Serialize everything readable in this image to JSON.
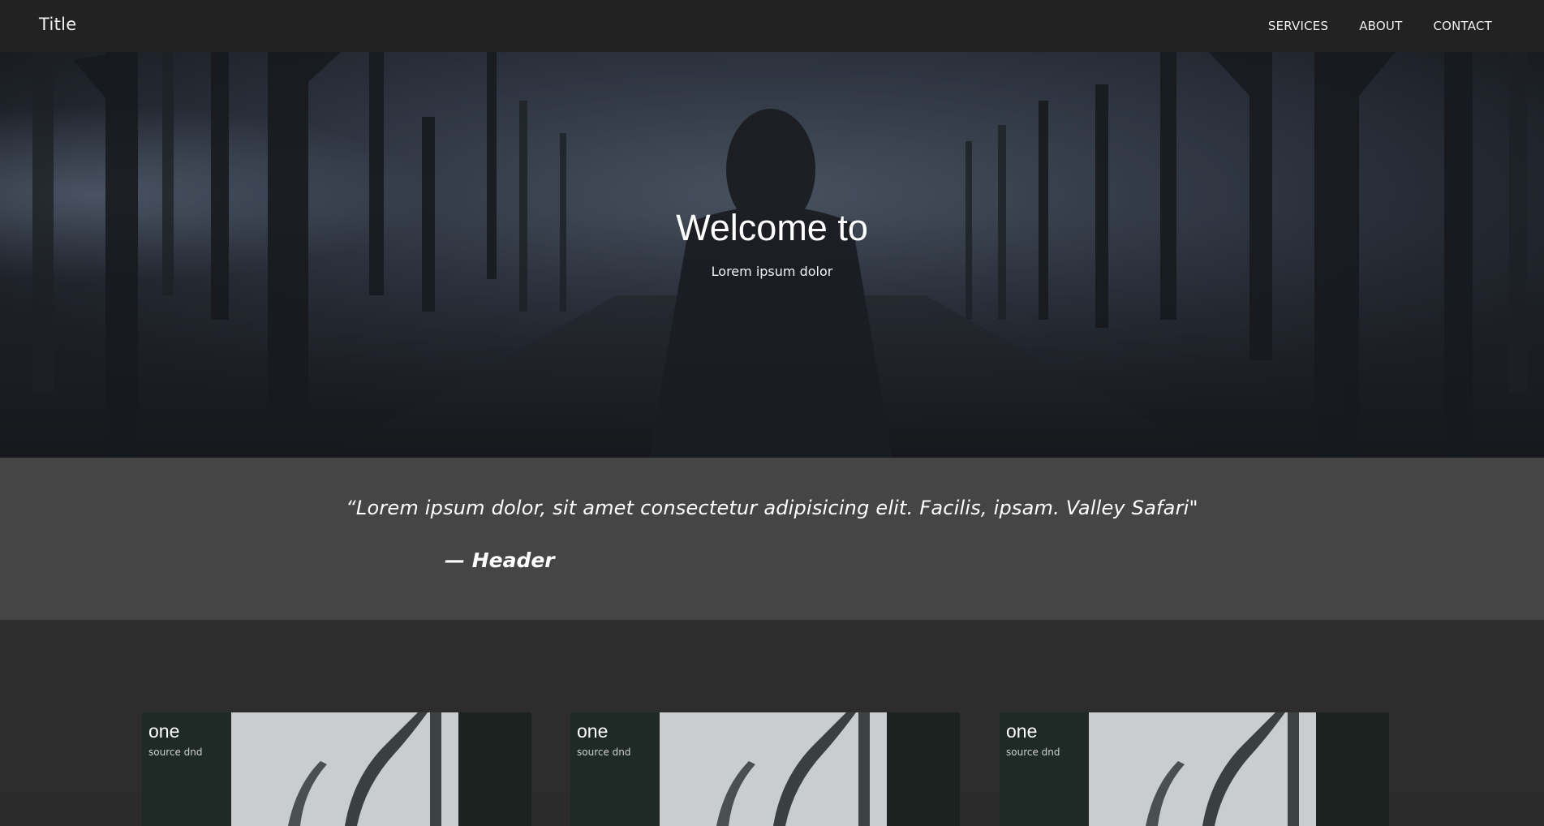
{
  "navbar": {
    "brand": "Title",
    "links": [
      "SERVICES",
      "ABOUT",
      "CONTACT"
    ]
  },
  "hero": {
    "title": "Welcome to",
    "subtitle": "Lorem ipsum dolor"
  },
  "quote": {
    "text": "“Lorem ipsum dolor, sit amet consectetur adipisicing elit. Facilis, ipsam. Valley Safari\"",
    "author": "— Header"
  },
  "cards": [
    {
      "title": "one",
      "source": "source dnd"
    },
    {
      "title": "one",
      "source": "source dnd"
    },
    {
      "title": "one",
      "source": "source dnd"
    }
  ],
  "colors": {
    "navbar_bg": "#222222",
    "quote_bg": "#454545",
    "section_bg": "#2d2d2d",
    "text": "#ffffff"
  }
}
